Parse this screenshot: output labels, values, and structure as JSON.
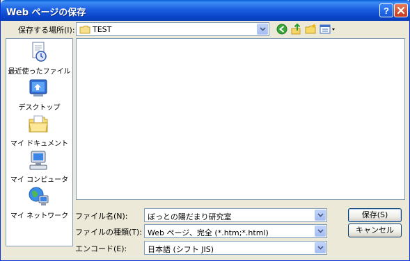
{
  "window": {
    "title": "Web ページの保存"
  },
  "save_in": {
    "label": "保存する場所(I):",
    "value": "TEST"
  },
  "places": [
    {
      "label": "最近使ったファイル",
      "icon": "recent-documents-icon"
    },
    {
      "label": "デスクトップ",
      "icon": "desktop-icon"
    },
    {
      "label": "マイ ドキュメント",
      "icon": "my-documents-icon"
    },
    {
      "label": "マイ コンピュータ",
      "icon": "my-computer-icon"
    },
    {
      "label": "マイ ネットワーク",
      "icon": "my-network-icon"
    }
  ],
  "fields": {
    "filename": {
      "label": "ファイル名(N):",
      "value": "ぼっとの陽だまり研究室"
    },
    "filetype": {
      "label": "ファイルの種類(T):",
      "value": "Web ページ、完全 (*.htm;*.html)"
    },
    "encoding": {
      "label": "エンコード(E):",
      "value": "日本語 (シフト JIS)"
    }
  },
  "buttons": {
    "save": "保存(S)",
    "cancel": "キャンセル"
  },
  "colors": {
    "titlebar": "#0b45c9",
    "dialog_bg": "#ece9d8",
    "field_border": "#7f9db9"
  }
}
